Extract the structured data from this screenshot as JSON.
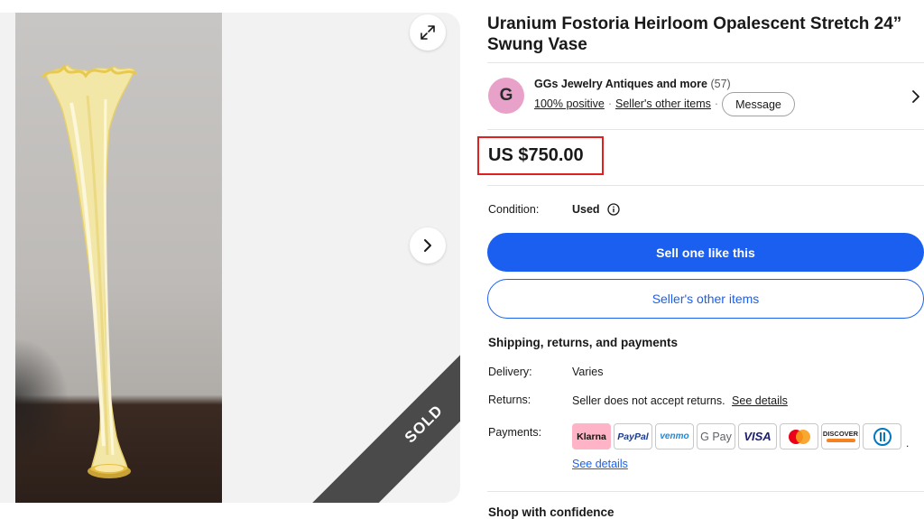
{
  "gallery": {
    "sold_label": "SOLD"
  },
  "item": {
    "title": "Uranium Fostoria Heirloom Opalescent Stretch 24” Swung Vase",
    "price": "US $750.00"
  },
  "seller": {
    "avatar_letter": "G",
    "avatar_color": "#e8a1c9",
    "name": "GGs Jewelry Antiques and more",
    "feedback_count": "(57)",
    "positive": "100% positive",
    "other_items_link": "Seller's other items",
    "message_button": "Message"
  },
  "condition": {
    "label": "Condition:",
    "value": "Used"
  },
  "actions": {
    "primary": "Sell one like this",
    "secondary": "Seller's other items",
    "primary_color": "#1a5fef"
  },
  "shipping": {
    "heading": "Shipping, returns, and payments",
    "delivery_label": "Delivery:",
    "delivery_value": "Varies",
    "returns_label": "Returns:",
    "returns_value": "Seller does not accept returns.",
    "returns_link": "See details",
    "payments_label": "Payments:",
    "payment_methods": {
      "klarna": "Klarna",
      "paypal": "PayPal",
      "venmo": "venmo",
      "gpay": "G Pay",
      "visa": "VISA",
      "mastercard": "mastercard-icon",
      "discover": "DISCOVER",
      "diners": "diners-club-icon"
    },
    "payments_link": "See details"
  },
  "confidence": {
    "heading": "Shop with confidence"
  }
}
